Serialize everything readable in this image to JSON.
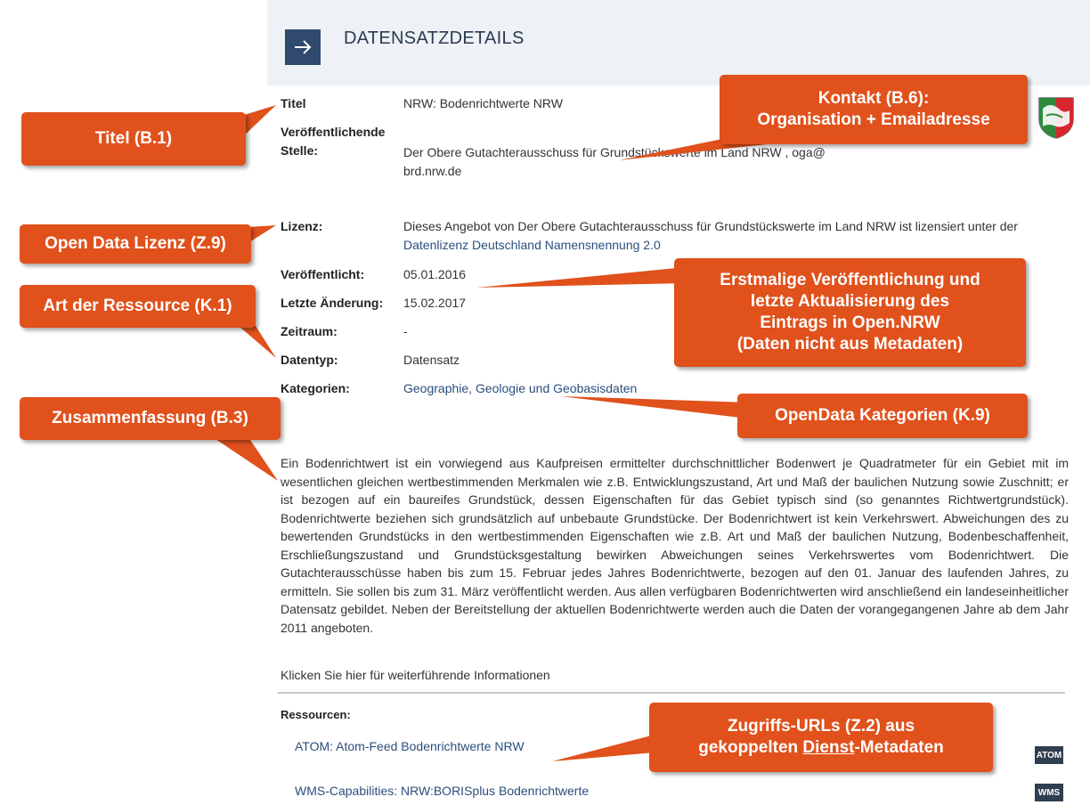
{
  "header": {
    "title": "DATENSATZDETAILS",
    "button_icon": "arrow-right-icon"
  },
  "details": {
    "title_label": "Titel",
    "title_value": "NRW: Bodenrichtwerte NRW",
    "publisher_label_1": "Veröffentlichende",
    "publisher_label_2": "Stelle:",
    "publisher_value_1": "Der Obere Gutachterausschuss für Grundstückswerte im Land NRW , oga@",
    "publisher_value_2": "brd.nrw.de",
    "license_label": "Lizenz:",
    "license_text": "Dieses Angebot von Der Obere Gutachterausschuss für Grundstückswerte im Land NRW ist lizensiert unter der",
    "license_link": "Datenlizenz Deutschland Namensnennung 2.0",
    "published_label": "Veröffentlicht:",
    "published_value": "05.01.2016",
    "modified_label": "Letzte Änderung:",
    "modified_value": "15.02.2017",
    "period_label": "Zeitraum:",
    "period_value": "-",
    "datatype_label": "Datentyp:",
    "datatype_value": "Datensatz",
    "categories_label": "Kategorien:",
    "categories_value": "Geographie, Geologie und Geobasisdaten"
  },
  "abstract": "Ein Bodenrichtwert ist ein vorwiegend aus Kaufpreisen ermittelter durchschnittlicher Bodenwert je Quadratmeter für ein Gebiet mit im wesentlichen gleichen wertbestimmenden Merkmalen wie z.B. Entwicklungszustand, Art und Maß der baulichen Nutzung sowie Zuschnitt; er ist bezogen auf ein baureifes Grundstück, dessen Eigenschaften für das Gebiet typisch sind (so genanntes Richtwertgrundstück). Bodenrichtwerte beziehen sich grundsätzlich auf unbebaute Grundstücke. Der Bodenrichtwert ist kein Verkehrswert. Abweichungen des zu bewertenden Grundstücks in den wertbestimmenden Eigenschaften wie z.B. Art und Maß der baulichen Nutzung, Bodenbeschaffenheit, Erschließungszustand und Grundstücksgestaltung bewirken Abweichungen seines Verkehrswertes vom Bodenrichtwert. Die Gutachterausschüsse haben bis zum 15. Februar jedes Jahres Bodenrichtwerte, bezogen auf den 01. Januar des laufenden Jahres, zu ermitteln. Sie sollen bis zum 31. März veröffentlicht werden. Aus allen verfügbaren Bodenrichtwerten wird anschließend ein landeseinheitlicher Datensatz gebildet. Neben der Bereitstellung der aktuellen Bodenrichtwerte werden auch die Daten der vorangegangenen Jahre ab dem Jahr 2011 angeboten.",
  "more_info_link": "Klicken Sie hier für weiterführende Informationen",
  "resources": {
    "label": "Ressourcen:",
    "items": [
      {
        "label": "ATOM: Atom-Feed Bodenrichtwerte NRW",
        "badge": "ATOM"
      },
      {
        "label": "WMS-Capabilities: NRW:BORISplus Bodenrichtwerte",
        "badge": "WMS"
      }
    ]
  },
  "callouts": {
    "titel": "Titel (B.1)",
    "kontakt_1": "Kontakt (B.6):",
    "kontakt_2": "Organisation + Emailadresse",
    "lizenz": "Open Data Lizenz (Z.9)",
    "ressource": "Art der Ressource (K.1)",
    "erstmalig_1": "Erstmalige Veröffentlichung und",
    "erstmalig_2": "letzte Aktualisierung des",
    "erstmalig_3": "Eintrags in Open.NRW",
    "erstmalig_4": "(Daten nicht aus Metadaten)",
    "zusammenfassung": "Zusammenfassung (B.3)",
    "kategorien": "OpenData Kategorien (K.9)",
    "zugriff_1": "Zugriffs-URLs (Z.2) aus",
    "zugriff_2a": "gekoppelten ",
    "zugriff_2b": "Dienst",
    "zugriff_2c": "-Metadaten"
  },
  "colors": {
    "callout": "#e0511c",
    "header_bg": "#eef1f5",
    "header_button": "#2f4a6d",
    "link": "#2b4e7d"
  },
  "icons": {
    "crest": "nrw-coat-of-arms-icon"
  }
}
